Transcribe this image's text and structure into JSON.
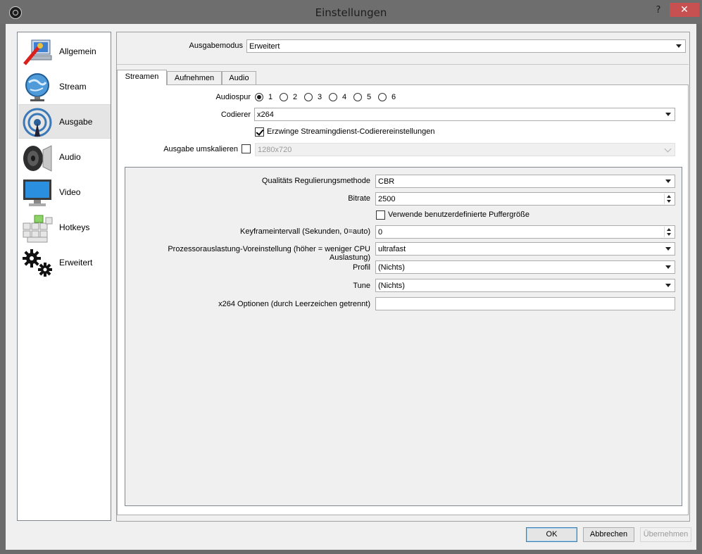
{
  "window": {
    "title": "Einstellungen",
    "help_glyph": "?",
    "close_glyph": "✕"
  },
  "sidebar": {
    "items": [
      {
        "label": "Allgemein",
        "icon": "general-icon"
      },
      {
        "label": "Stream",
        "icon": "stream-globe-icon"
      },
      {
        "label": "Ausgabe",
        "icon": "output-antenna-icon",
        "selected": true
      },
      {
        "label": "Audio",
        "icon": "speaker-icon"
      },
      {
        "label": "Video",
        "icon": "monitor-icon"
      },
      {
        "label": "Hotkeys",
        "icon": "keyboard-icon"
      },
      {
        "label": "Erweitert",
        "icon": "gears-icon"
      }
    ]
  },
  "output_mode": {
    "label": "Ausgabemodus",
    "value": "Erweitert"
  },
  "tabs": [
    {
      "label": "Streamen",
      "selected": true
    },
    {
      "label": "Aufnehmen"
    },
    {
      "label": "Audio"
    }
  ],
  "streaming": {
    "audio_track": {
      "label": "Audiospur",
      "options": [
        "1",
        "2",
        "3",
        "4",
        "5",
        "6"
      ],
      "selected": "1"
    },
    "encoder": {
      "label": "Codierer",
      "value": "x264"
    },
    "enforce": {
      "label": "Erzwinge Streamingdienst-Codierereinstellungen",
      "checked": true
    },
    "rescale": {
      "label": "Ausgabe umskalieren",
      "checked": false,
      "value": "1280x720"
    },
    "rate_control": {
      "label": "Qualitäts Regulierungsmethode",
      "value": "CBR"
    },
    "bitrate": {
      "label": "Bitrate",
      "value": "2500"
    },
    "custom_buffer": {
      "label": "Verwende benutzerdefinierte Puffergröße",
      "checked": false
    },
    "keyframe": {
      "label": "Keyframeintervall (Sekunden, 0=auto)",
      "value": "0"
    },
    "preset": {
      "label": "Prozessorauslastung-Voreinstellung (höher = weniger CPU Auslastung)",
      "value": "ultrafast"
    },
    "profile": {
      "label": "Profil",
      "value": "(Nichts)"
    },
    "tune": {
      "label": "Tune",
      "value": "(Nichts)"
    },
    "x264_opts": {
      "label": "x264 Optionen (durch Leerzeichen getrennt)",
      "value": ""
    }
  },
  "buttons": {
    "ok": "OK",
    "cancel": "Abbrechen",
    "apply": "Übernehmen"
  },
  "colors": {
    "close_button": "#c75050",
    "selected_sidebar": "#e5e5e5",
    "titlebar": "#6e6e6e"
  }
}
